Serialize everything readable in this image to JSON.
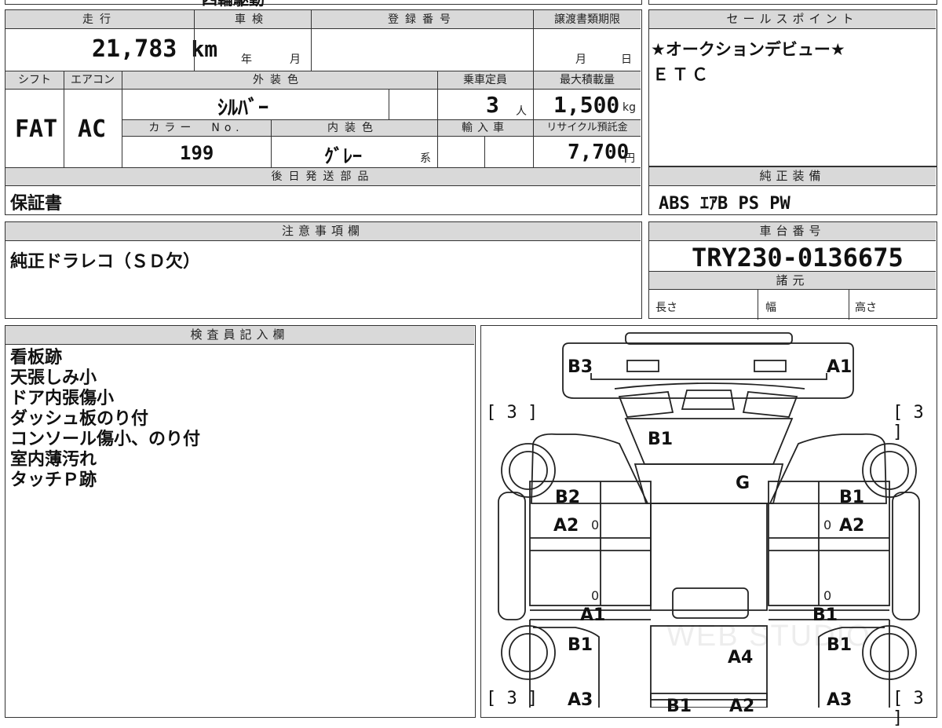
{
  "top_strip": {
    "partial": "四輪駆動"
  },
  "vehicle": {
    "mileage_label": "走行",
    "mileage_value": "21,783",
    "mileage_unit": "km",
    "inspection_label": "車検",
    "inspection_year": "年",
    "inspection_month": "月",
    "registration_label": "登録番号",
    "transfer_label": "譲渡書類期限",
    "transfer_month": "月",
    "transfer_day": "日",
    "shift_label": "シフト",
    "shift_value": "FAT",
    "ac_label": "エアコン",
    "ac_value": "AC",
    "exterior_color_label": "外装色",
    "exterior_color_value": "ｼﾙﾊﾞｰ",
    "color_no_label": "カラー　No.",
    "color_no_value": "199",
    "interior_color_label": "内装色",
    "interior_color_value": "ｸﾞﾚｰ",
    "interior_color_suffix": "系",
    "capacity_label": "乗車定員",
    "capacity_value": "3",
    "capacity_unit": "人",
    "max_load_label": "最大積載量",
    "max_load_value": "1,500",
    "max_load_unit": "kg",
    "import_label": "輸入車",
    "recycle_label": "リサイクル預託金",
    "recycle_value": "7,700",
    "recycle_unit": "円",
    "later_parts_label": "後日発送部品",
    "later_parts_value": "保証書"
  },
  "sales_point": {
    "label": "セールスポイント",
    "lines": [
      "★オークションデビュー★",
      "ＥＴＣ"
    ]
  },
  "equipment": {
    "label": "純正装備",
    "value": "ABS ｴｱB PS PW"
  },
  "notes": {
    "label": "注意事項欄",
    "value": "純正ドラレコ（ＳＤ欠）"
  },
  "chassis": {
    "label": "車台番号",
    "value": "TRY230-0136675",
    "specs_label": "諸元",
    "length_label": "長さ",
    "width_label": "幅",
    "height_label": "高さ"
  },
  "inspector": {
    "label": "検査員記入欄",
    "lines": [
      "看板跡",
      "天張しみ小",
      "ドア内張傷小",
      "ダッシュ板のり付",
      "コンソール傷小、のり付",
      "室内薄汚れ",
      "タッチＰ跡"
    ]
  },
  "diagram": {
    "tire_top_left": "[ 3 ]",
    "tire_top_right": "[ 3 ]",
    "tire_bottom_left": "[ 3 ]",
    "tire_bottom_right": "[ 3 ]",
    "damage": {
      "front_left": "B3",
      "front_right": "A1",
      "hood": "B1",
      "windshield": "G",
      "left_front_fender": "B2",
      "left_front_door": "A2",
      "right_front_fender": "B1",
      "right_front_door": "A2",
      "left_sill": "A1",
      "right_sill": "B1",
      "left_rear_upper": "B1",
      "right_rear_upper": "B1",
      "bed": "A4",
      "left_rear_lower": "A3",
      "right_rear_lower": "A3",
      "tailgate_left": "B1",
      "tailgate_right": "A2",
      "small_marks": [
        "0",
        "0",
        "0",
        "0"
      ]
    },
    "watermark": "WEB STUDIO"
  }
}
